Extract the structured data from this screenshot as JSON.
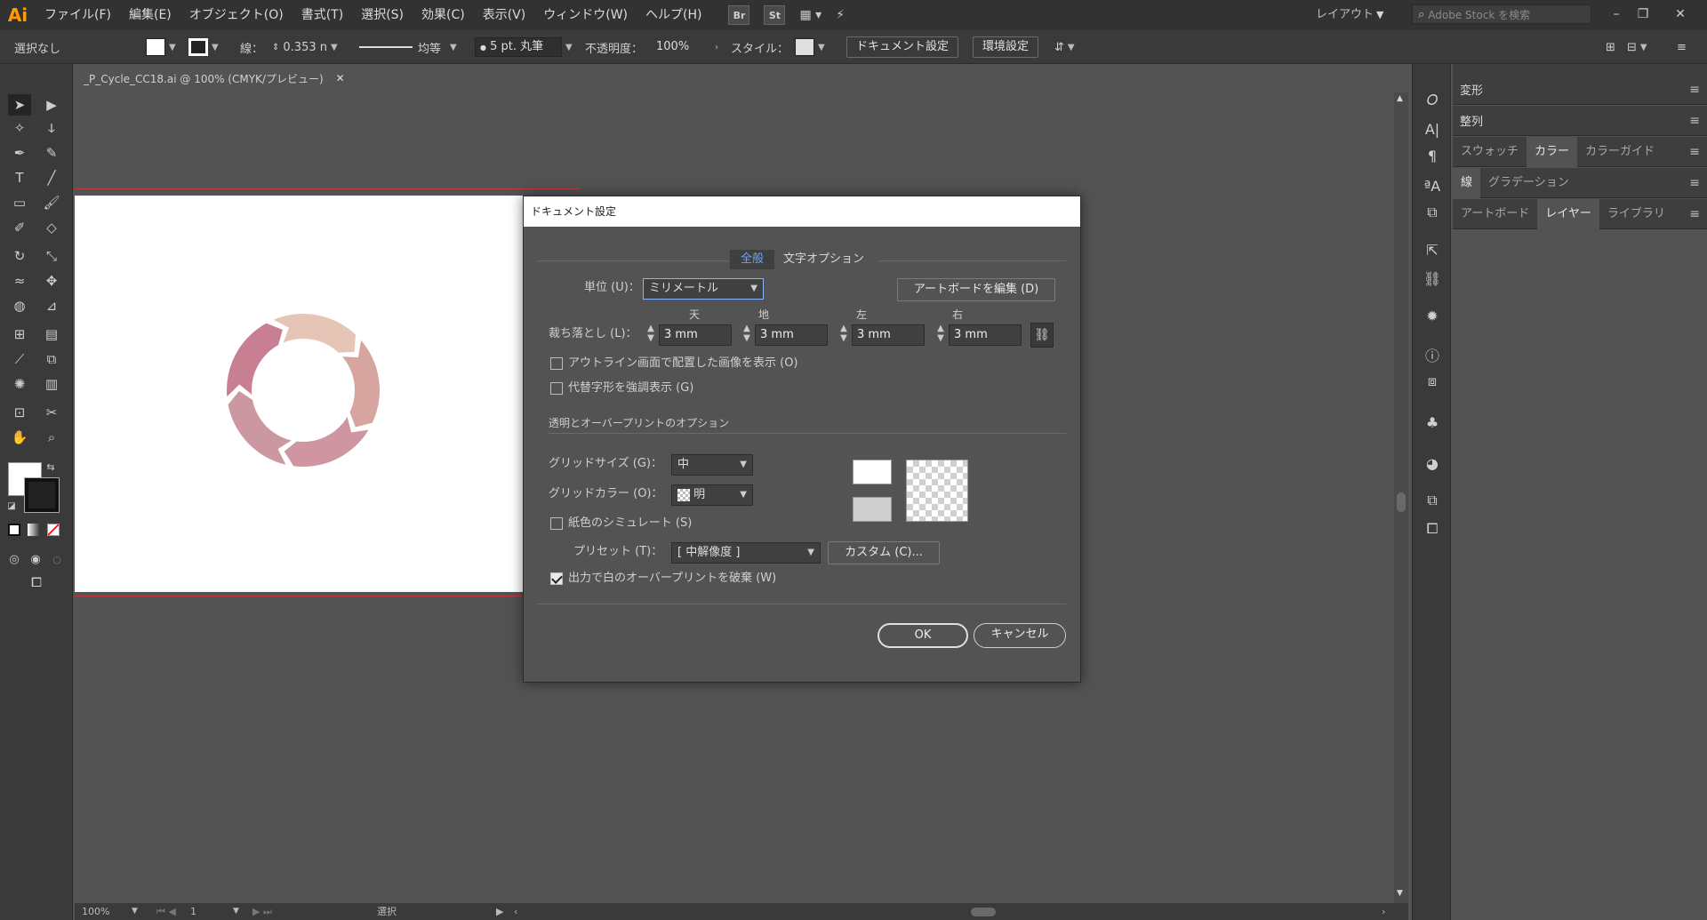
{
  "app": {
    "logo": "Ai"
  },
  "menus": [
    "ファイル(F)",
    "編集(E)",
    "オブジェクト(O)",
    "書式(T)",
    "選択(S)",
    "効果(C)",
    "表示(V)",
    "ウィンドウ(W)",
    "ヘルプ(H)"
  ],
  "menubar_icons": {
    "bridge": "Br",
    "stock": "St"
  },
  "workspace": "レイアウト",
  "search_placeholder": "Adobe Stock を検索",
  "control": {
    "selection": "選択なし",
    "stroke_label": "線：",
    "stroke_width": "0.353 n",
    "profile": "均等",
    "brush": "5 pt. 丸筆",
    "opacity_label": "不透明度：",
    "opacity": "100%",
    "style_label": "スタイル：",
    "doc_setup_btn": "ドキュメント設定",
    "prefs_btn": "環境設定"
  },
  "document_tab": "_P_Cycle_CC18.ai @ 100% (CMYK/プレビュー)",
  "status": {
    "zoom": "100%",
    "artboard_num": "1",
    "mode": "選択"
  },
  "panels": {
    "transform": "変形",
    "align": "整列",
    "tabs_row1": [
      "スウォッチ",
      "カラー",
      "カラーガイド"
    ],
    "tabs_row2": [
      "線",
      "グラデーション"
    ],
    "tabs_row3": [
      "アートボード",
      "レイヤー",
      "ライブラリ"
    ]
  },
  "dialog": {
    "title": "ドキュメント設定",
    "tabs": [
      "全般",
      "文字オプション"
    ],
    "units_label": "単位 (U)：",
    "units_value": "ミリメートル",
    "edit_artboard_btn": "アートボードを編集 (D)",
    "bleed_label": "裁ち落とし (L)：",
    "bleed_headers": [
      "天",
      "地",
      "左",
      "右"
    ],
    "bleed_values": [
      "3 mm",
      "3 mm",
      "3 mm",
      "3 mm"
    ],
    "show_images_outline": "アウトライン画面で配置した画像を表示 (O)",
    "highlight_glyphs": "代替字形を強調表示 (G)",
    "transparency_section": "透明とオーバープリントのオプション",
    "grid_size_label": "グリッドサイズ (G)：",
    "grid_size_value": "中",
    "grid_color_label": "グリッドカラー (O)：",
    "grid_color_value": "明",
    "simulate_paper": "紙色のシミュレート (S)",
    "preset_label": "プリセット (T)：",
    "preset_value": "[ 中解像度 ]",
    "custom_btn": "カスタム (C)...",
    "discard_white_overprint": "出力で白のオーバープリントを破棄 (W)",
    "ok": "OK",
    "cancel": "キャンセル"
  },
  "colors": {
    "cycle_segments": [
      "#e6c4b6",
      "#d7a5a0",
      "#cf95a0",
      "#cb98a2",
      "#c77f91"
    ],
    "bleed_line": "#c2393b",
    "active_tab": "#65a6ff"
  }
}
